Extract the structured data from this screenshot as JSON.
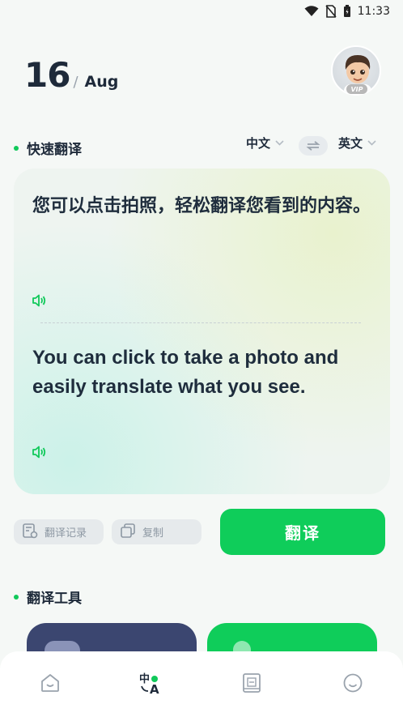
{
  "status_bar": {
    "time": "11:33"
  },
  "header": {
    "day": "16",
    "separator": "/",
    "month": "Aug",
    "vip_label": "VIP"
  },
  "quick_translate": {
    "title": "快速翻译",
    "source_lang": "中文",
    "target_lang": "英文",
    "source_text": "您可以点击拍照，轻松翻译您看到的内容。",
    "target_text": "You can click to take a photo and easily translate what you see."
  },
  "actions": {
    "history_label": "翻译记录",
    "copy_label": "复制",
    "translate_label": "翻译"
  },
  "tools": {
    "title": "翻译工具"
  },
  "colors": {
    "accent": "#0fcd5a",
    "tool_card_dark": "#3b4670",
    "tool_card_green": "#0fcd5a"
  },
  "nav": {
    "items": [
      {
        "icon": "home-icon",
        "active": false
      },
      {
        "icon": "translate-icon",
        "active": true
      },
      {
        "icon": "dictionary-icon",
        "active": false
      },
      {
        "icon": "profile-icon",
        "active": false
      }
    ]
  }
}
